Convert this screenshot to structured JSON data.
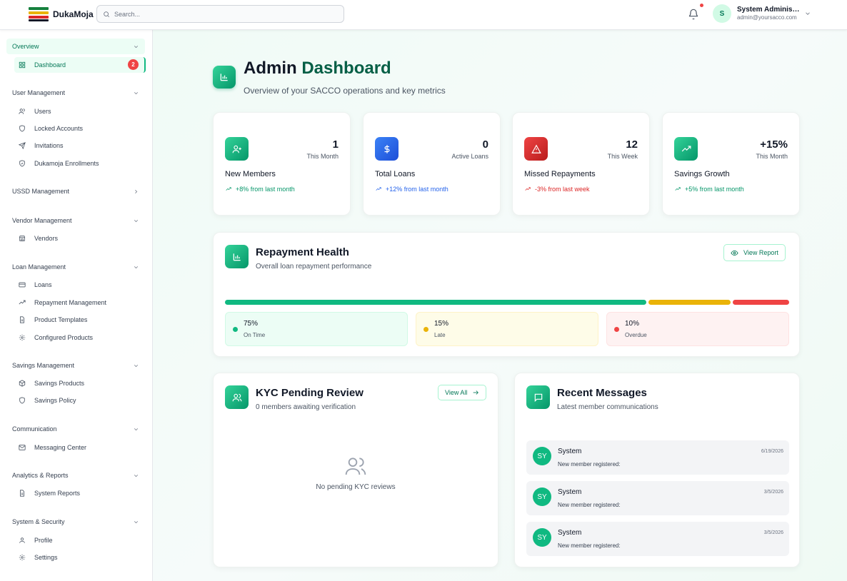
{
  "header": {
    "logo_text": "DukaMoja",
    "search_placeholder": "Search...",
    "user_name": "System Administrator",
    "user_email": "admin@yoursacco.com",
    "user_initial": "S"
  },
  "sidebar": {
    "sections": [
      {
        "label": "Overview",
        "items": [
          {
            "label": "Dashboard",
            "icon": "grid-icon",
            "badge": "2"
          }
        ]
      },
      {
        "label": "User Management",
        "items": [
          {
            "label": "Users",
            "icon": "users-icon"
          },
          {
            "label": "Locked Accounts",
            "icon": "shield-icon"
          },
          {
            "label": "Invitations",
            "icon": "send-icon"
          },
          {
            "label": "Dukamoja Enrollments",
            "icon": "shield-check-icon"
          }
        ]
      },
      {
        "label": "USSD Management",
        "items": []
      },
      {
        "label": "Vendor Management",
        "items": [
          {
            "label": "Vendors",
            "icon": "store-icon"
          }
        ]
      },
      {
        "label": "Loan Management",
        "items": [
          {
            "label": "Loans",
            "icon": "card-icon"
          },
          {
            "label": "Repayment Management",
            "icon": "trend-icon"
          },
          {
            "label": "Product Templates",
            "icon": "file-icon"
          },
          {
            "label": "Configured Products",
            "icon": "gear-icon"
          }
        ]
      },
      {
        "label": "Savings Management",
        "items": [
          {
            "label": "Savings Products",
            "icon": "box-icon"
          },
          {
            "label": "Savings Policy",
            "icon": "shield-icon"
          }
        ]
      },
      {
        "label": "Communication",
        "items": [
          {
            "label": "Messaging Center",
            "icon": "mail-icon"
          }
        ]
      },
      {
        "label": "Analytics & Reports",
        "items": [
          {
            "label": "System Reports",
            "icon": "file-icon"
          }
        ]
      },
      {
        "label": "System & Security",
        "items": [
          {
            "label": "Profile",
            "icon": "user-icon"
          },
          {
            "label": "Settings",
            "icon": "gear-icon"
          }
        ]
      }
    ]
  },
  "page": {
    "title_part1": "Admin",
    "title_part2": "Dashboard",
    "subtitle": "Overview of your SACCO operations and key metrics"
  },
  "stats": [
    {
      "value": "1",
      "sub": "This Month",
      "label": "New Members",
      "trend": "+8% from last month",
      "color": "#059669",
      "icon": "user-plus-icon"
    },
    {
      "value": "0",
      "sub": "Active Loans",
      "label": "Total Loans",
      "trend": "+12% from last month",
      "color": "#2563eb",
      "icon": "dollar-icon"
    },
    {
      "value": "12",
      "sub": "This Week",
      "label": "Missed Repayments",
      "trend": "-3% from last week",
      "color": "#dc2626",
      "icon": "alert-icon"
    },
    {
      "value": "+15%",
      "sub": "This Month",
      "label": "Savings Growth",
      "trend": "+5% from last month",
      "color": "#059669",
      "icon": "trend-icon"
    }
  ],
  "repayment": {
    "title": "Repayment Health",
    "subtitle": "Overall loan repayment performance",
    "button": "View Report",
    "segments": [
      {
        "pct": "75%",
        "label": "On Time",
        "value": 0.75,
        "color": "#10b981"
      },
      {
        "pct": "15%",
        "label": "Late",
        "value": 0.15,
        "color": "#eab308"
      },
      {
        "pct": "10%",
        "label": "Overdue",
        "value": 0.1,
        "color": "#ef4444"
      }
    ]
  },
  "kyc": {
    "title": "KYC Pending Review",
    "subtitle": "0 members awaiting verification",
    "button": "View All",
    "empty_text": "No pending KYC reviews"
  },
  "messages": {
    "title": "Recent Messages",
    "subtitle": "Latest member communications",
    "items": [
      {
        "initials": "SY",
        "name": "System",
        "text": "New member registered:",
        "date": "6/19/2026"
      },
      {
        "initials": "SY",
        "name": "System",
        "text": "New member registered:",
        "date": "3/5/2026"
      },
      {
        "initials": "SY",
        "name": "System",
        "text": "New member registered:",
        "date": "3/5/2026"
      }
    ]
  }
}
